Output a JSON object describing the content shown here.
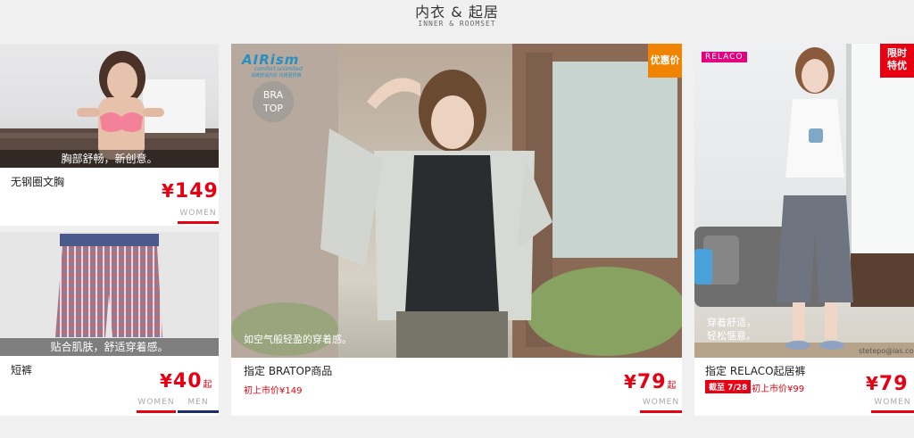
{
  "header": {
    "title": "内衣 & 起居",
    "subtitle": "INNER & ROOMSET"
  },
  "cards": {
    "bra": {
      "caption": "胸部舒畅，新创意。",
      "name": "无钢圈文胸",
      "yen": "¥",
      "price": "149",
      "gender": "WOMEN"
    },
    "shorts": {
      "caption": "贴合肌肤，舒适穿着感。",
      "name": "短裤",
      "yen": "¥",
      "price": "40",
      "qi": "起",
      "gender_women": "WOMEN",
      "gender_men": "MEN"
    },
    "bratop": {
      "airism_logo": "AIRism",
      "airism_sub": "comfort unlimited",
      "airism_sub2": "清爽舒适内衣 内搭更舒爽",
      "bratop_logo_1": "BRA",
      "bratop_logo_2": "TOP",
      "tag": "优惠价",
      "caption": "如空气般轻盈的穿着感。",
      "name": "指定 BRATOP商品",
      "orig": "初上市价¥149",
      "yen": "¥",
      "price": "79",
      "qi": "起",
      "gender": "WOMEN"
    },
    "relaco": {
      "brand": "RELACO",
      "tag_line1": "限时",
      "tag_line2": "特优",
      "caption_line1": "穿着舒适，",
      "caption_line2": "轻松惬意。",
      "watermark": "stetepo@ias.co.ltd",
      "name": "指定 RELACO起居裤",
      "deadline": "截至 7/28",
      "orig": "初上市价¥99",
      "yen": "¥",
      "price": "79",
      "gender": "WOMEN"
    }
  },
  "colors": {
    "accent": "#e60012",
    "navy": "#1a2a6c",
    "orange_tag": "#f08300",
    "pink_brand": "#e4007f"
  }
}
